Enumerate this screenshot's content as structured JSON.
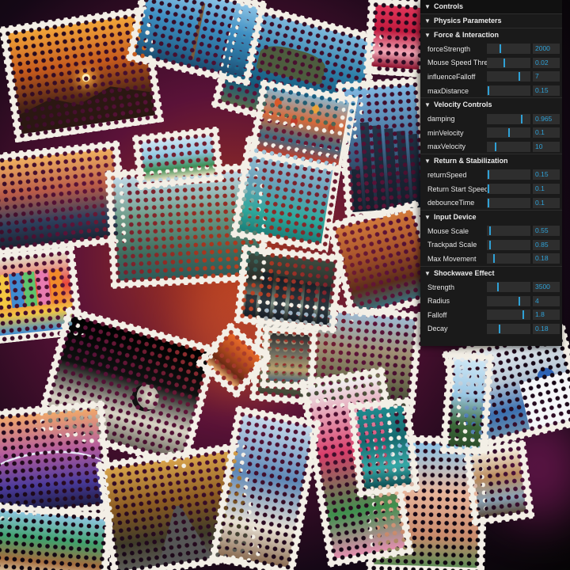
{
  "scene": {
    "photos": [
      {
        "name": "photo-sunset-mountains",
        "colors": [
          "#f2a53a",
          "#c55a1d",
          "#4a2416",
          "#1c1316"
        ],
        "subject": "sun"
      },
      {
        "name": "photo-island-bridge",
        "colors": [
          "#7fb9dd",
          "#2e7fa8",
          "#14597b",
          "#5b6b4b"
        ],
        "subject": "island"
      },
      {
        "name": "photo-signpost-sea",
        "colors": [
          "#8cc3e6",
          "#3f8fc2",
          "#2a6e9a",
          "#1b4c6e"
        ],
        "subject": "sign"
      },
      {
        "name": "photo-red-gift",
        "colors": [
          "#e0365a",
          "#c0193d",
          "#f2a8b7",
          "#8c0f2c"
        ],
        "subject": "none"
      },
      {
        "name": "photo-venice-canal",
        "colors": [
          "#f0b060",
          "#b85a48",
          "#2d3f5c",
          "#1c2433"
        ],
        "subject": "none"
      },
      {
        "name": "photo-city-skyline",
        "colors": [
          "#7fb6e0",
          "#46739c",
          "#293a52",
          "#1a2433"
        ],
        "subject": "towers"
      },
      {
        "name": "photo-cliffs-lagoon",
        "colors": [
          "#bfd8e6",
          "#6c9a86",
          "#3f6c5e",
          "#2f5a58"
        ],
        "subject": "none"
      },
      {
        "name": "photo-turquoise-lake",
        "colors": [
          "#a9cde0",
          "#6aa0b8",
          "#2fa89c",
          "#1b7e78"
        ],
        "subject": "none"
      },
      {
        "name": "photo-hot-air-balloons",
        "colors": [
          "#8bb6cc",
          "#d86a3a",
          "#3e6c84",
          "#c23d2a"
        ],
        "subject": "balloons"
      },
      {
        "name": "photo-beach-huts",
        "colors": [
          "#e4d9c5",
          "#e9473b",
          "#f3c742",
          "#3f8bd0"
        ],
        "subject": "huts"
      },
      {
        "name": "photo-moon",
        "colors": [
          "#000000",
          "#111111",
          "#d8d2c4",
          "#6f6a60"
        ],
        "subject": "moon"
      },
      {
        "name": "photo-canyon-river",
        "colors": [
          "#d27a3c",
          "#a4502a",
          "#5a2c1a",
          "#3c6e7a"
        ],
        "subject": "none"
      },
      {
        "name": "photo-mountain-valley",
        "colors": [
          "#9fbad1",
          "#a08f74",
          "#6d6a4e",
          "#3e4434"
        ],
        "subject": "none"
      },
      {
        "name": "photo-train-window",
        "colors": [
          "#2b2b2b",
          "#6c6b5f",
          "#b8a16e",
          "#4c6577"
        ],
        "subject": "none"
      },
      {
        "name": "photo-santorini",
        "colors": [
          "#e9eef2",
          "#b6c6d4",
          "#3b6fb0",
          "#6a8fae"
        ],
        "subject": "dome"
      },
      {
        "name": "photo-purple-bridge",
        "colors": [
          "#f0a96a",
          "#b35b9c",
          "#4a3a9a",
          "#1e1e45"
        ],
        "subject": "arc"
      },
      {
        "name": "photo-forest-road",
        "colors": [
          "#d7a24a",
          "#8a5a22",
          "#3e3a28",
          "#5c5c58"
        ],
        "subject": "road"
      },
      {
        "name": "photo-adobe-cactus",
        "colors": [
          "#8cc3e6",
          "#e7b49a",
          "#c98a6c",
          "#5d8a55"
        ],
        "subject": "none"
      },
      {
        "name": "photo-flower-arch",
        "colors": [
          "#f0f0f0",
          "#d73d6a",
          "#3f8f4d",
          "#e58fb0"
        ],
        "subject": "none"
      },
      {
        "name": "photo-palm-beach",
        "colors": [
          "#cfe6f2",
          "#8fc6e0",
          "#3e8f56",
          "#f0e2c4"
        ],
        "subject": "none"
      },
      {
        "name": "photo-alley-blue",
        "colors": [
          "#c6d9ea",
          "#5d86b5",
          "#e9e1d4",
          "#8a6c52"
        ],
        "subject": "none"
      },
      {
        "name": "photo-tropical-hut",
        "colors": [
          "#8fc6e0",
          "#3fa06c",
          "#a36b3d",
          "#e2d2b0"
        ],
        "subject": "none"
      },
      {
        "name": "photo-dark-architecture",
        "colors": [
          "#3c4a3f",
          "#2b2f2a",
          "#7c8e84",
          "#1c1f1d"
        ],
        "subject": "towers"
      },
      {
        "name": "photo-teal-sea",
        "colors": [
          "#1f8a8e",
          "#16696e",
          "#35a8a6",
          "#0e4c52"
        ],
        "subject": "none"
      },
      {
        "name": "photo-palm-sky",
        "colors": [
          "#cde6f5",
          "#9bc7e4",
          "#3c6a3a",
          "#2b4a28"
        ],
        "subject": "none"
      },
      {
        "name": "photo-cafe-street",
        "colors": [
          "#f2e9da",
          "#b9895a",
          "#8aa2b6",
          "#5a4a3a"
        ],
        "subject": "none"
      },
      {
        "name": "photo-orange-street",
        "colors": [
          "#e86a2a",
          "#b34a1e",
          "#6a2a14",
          "#f0b070"
        ],
        "subject": "none"
      }
    ]
  },
  "gui": {
    "title": "Controls",
    "physics_title": "Physics Parameters",
    "folders": [
      {
        "title": "Force & Interaction",
        "controls": [
          {
            "label": "forceStrength",
            "value": "2000",
            "level": 0.3
          },
          {
            "label": "Mouse Speed Threshold",
            "value": "0.02",
            "level": 0.4
          },
          {
            "label": "influenceFalloff",
            "value": "7",
            "level": 0.75
          },
          {
            "label": "maxDistance",
            "value": "0.15",
            "level": 0.02
          }
        ]
      },
      {
        "title": "Velocity Controls",
        "controls": [
          {
            "label": "damping",
            "value": "0.965",
            "level": 0.82
          },
          {
            "label": "minVelocity",
            "value": "0.1",
            "level": 0.5
          },
          {
            "label": "maxVelocity",
            "value": "10",
            "level": 0.18
          }
        ]
      },
      {
        "title": "Return & Stabilization",
        "controls": [
          {
            "label": "returnSpeed",
            "value": "0.15",
            "level": 0.02
          },
          {
            "label": "Return Start Speed",
            "value": "0.1",
            "level": 0.02
          },
          {
            "label": "debounceTime",
            "value": "0.1",
            "level": 0.02
          }
        ]
      },
      {
        "title": "Input Device",
        "controls": [
          {
            "label": "Mouse Scale",
            "value": "0.55",
            "level": 0.05
          },
          {
            "label": "Trackpad Scale",
            "value": "0.85",
            "level": 0.05
          },
          {
            "label": "Max Movement",
            "value": "0.18",
            "level": 0.15
          }
        ]
      },
      {
        "title": "Shockwave Effect",
        "controls": [
          {
            "label": "Strength",
            "value": "3500",
            "level": 0.25
          },
          {
            "label": "Radius",
            "value": "4",
            "level": 0.75
          },
          {
            "label": "Falloff",
            "value": "1.8",
            "level": 0.85
          },
          {
            "label": "Decay",
            "value": "0.18",
            "level": 0.28
          }
        ]
      }
    ]
  }
}
